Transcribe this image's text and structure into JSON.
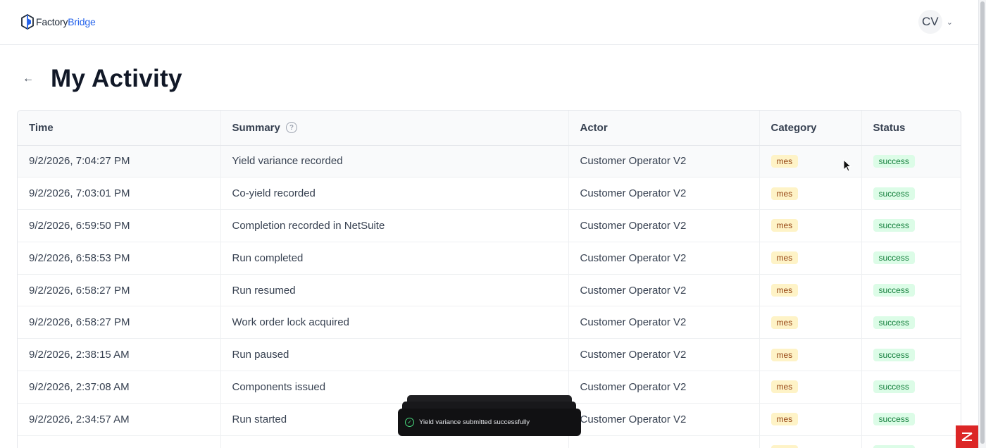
{
  "brand": {
    "part1": "Factory",
    "part2": "Bridge",
    "color": "#2563eb"
  },
  "user": {
    "initials": "CV"
  },
  "page": {
    "title": "My Activity"
  },
  "table": {
    "headers": {
      "time": "Time",
      "summary": "Summary",
      "actor": "Actor",
      "category": "Category",
      "status": "Status"
    },
    "rows": [
      {
        "time": "9/2/2026, 7:04:27 PM",
        "summary": "Yield variance recorded",
        "actor": "Customer Operator V2",
        "category": "mes",
        "status": "success"
      },
      {
        "time": "9/2/2026, 7:03:01 PM",
        "summary": "Co-yield recorded",
        "actor": "Customer Operator V2",
        "category": "mes",
        "status": "success"
      },
      {
        "time": "9/2/2026, 6:59:50 PM",
        "summary": "Completion recorded in NetSuite",
        "actor": "Customer Operator V2",
        "category": "mes",
        "status": "success"
      },
      {
        "time": "9/2/2026, 6:58:53 PM",
        "summary": "Run completed",
        "actor": "Customer Operator V2",
        "category": "mes",
        "status": "success"
      },
      {
        "time": "9/2/2026, 6:58:27 PM",
        "summary": "Run resumed",
        "actor": "Customer Operator V2",
        "category": "mes",
        "status": "success"
      },
      {
        "time": "9/2/2026, 6:58:27 PM",
        "summary": "Work order lock acquired",
        "actor": "Customer Operator V2",
        "category": "mes",
        "status": "success"
      },
      {
        "time": "9/2/2026, 2:38:15 AM",
        "summary": "Run paused",
        "actor": "Customer Operator V2",
        "category": "mes",
        "status": "success"
      },
      {
        "time": "9/2/2026, 2:37:08 AM",
        "summary": "Components issued",
        "actor": "Customer Operator V2",
        "category": "mes",
        "status": "success"
      },
      {
        "time": "9/2/2026, 2:34:57 AM",
        "summary": "Run started",
        "actor": "Customer Operator V2",
        "category": "mes",
        "status": "success"
      },
      {
        "time": "",
        "summary": "",
        "actor": "",
        "category": "mes",
        "status": "success"
      }
    ]
  },
  "toast": {
    "message": "Yield variance submitted successfully"
  }
}
